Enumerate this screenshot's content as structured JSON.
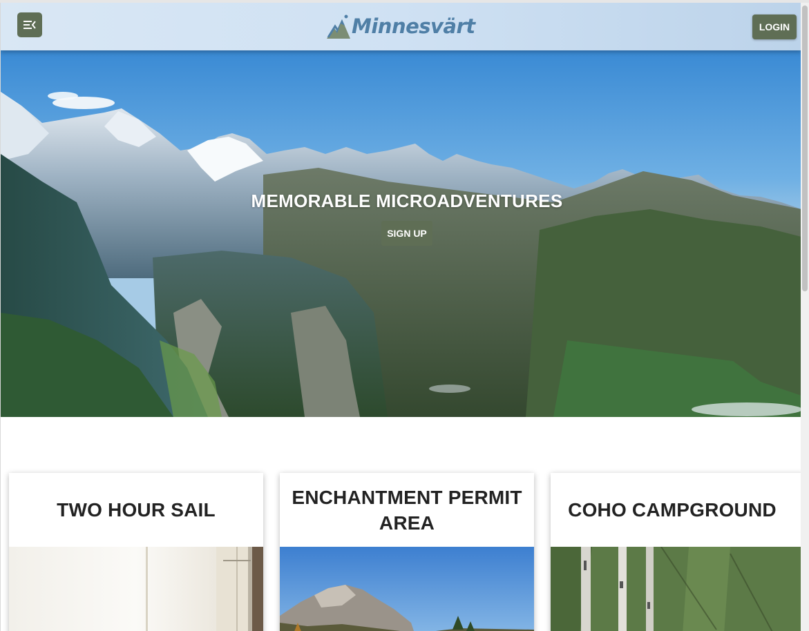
{
  "header": {
    "logo_text": "Minnesvärt",
    "login_label": "LOGIN",
    "menu_icon": "menu-collapse-icon"
  },
  "hero": {
    "title": "MEMORABLE MICROADVENTURES",
    "signup_label": "SIGN UP"
  },
  "cards": [
    {
      "title": "TWO HOUR SAIL"
    },
    {
      "title": "ENCHANTMENT PERMIT AREA"
    },
    {
      "title": "COHO CAMPGROUND"
    }
  ],
  "colors": {
    "accent": "#5f6e55",
    "logo": "#4f7fa6"
  }
}
